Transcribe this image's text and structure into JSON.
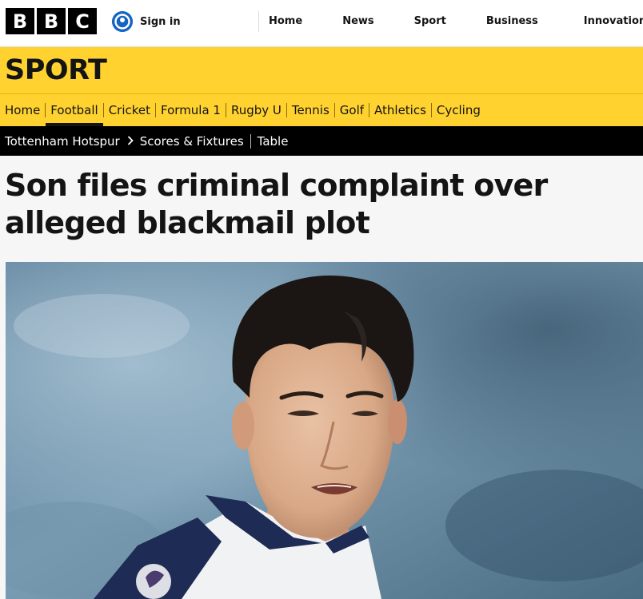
{
  "header": {
    "logo_letters": [
      "B",
      "B",
      "C"
    ],
    "signin_label": "Sign in",
    "nav": [
      {
        "label": "Home"
      },
      {
        "label": "News"
      },
      {
        "label": "Sport"
      },
      {
        "label": "Business"
      },
      {
        "label": "Innovation"
      }
    ]
  },
  "sport": {
    "title": "SPORT",
    "nav": [
      {
        "label": "Home",
        "active": false
      },
      {
        "label": "Football",
        "active": true
      },
      {
        "label": "Cricket",
        "active": false
      },
      {
        "label": "Formula 1",
        "active": false
      },
      {
        "label": "Rugby U",
        "active": false
      },
      {
        "label": "Tennis",
        "active": false
      },
      {
        "label": "Golf",
        "active": false
      },
      {
        "label": "Athletics",
        "active": false
      },
      {
        "label": "Cycling",
        "active": false
      }
    ],
    "subnav": {
      "team": "Tottenham Hotspur",
      "links": [
        {
          "label": "Scores & Fixtures"
        },
        {
          "label": "Table"
        }
      ]
    }
  },
  "article": {
    "headline": "Son files criminal complaint over alleged blackmail plot",
    "hero_image": {
      "kind": "photo",
      "description_icon": "player-photo"
    }
  },
  "colors": {
    "sport_yellow": "#ffd230",
    "subnav_black": "#000000",
    "signin_blue": "#1565c0",
    "text": "#141414"
  }
}
